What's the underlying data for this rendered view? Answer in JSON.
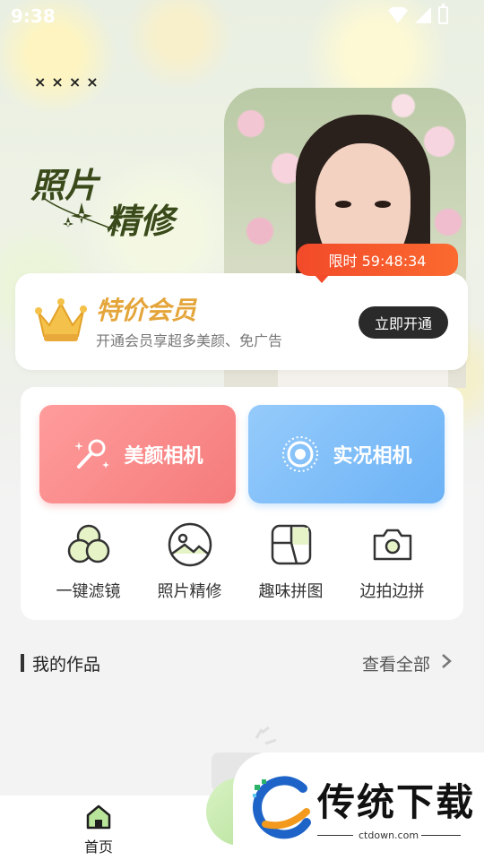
{
  "status_bar": {
    "time": "9:38"
  },
  "hero": {
    "close_marks": "××××",
    "title_line1": "照片",
    "title_line2": "精修"
  },
  "promo": {
    "countdown": "限时 59:48:34",
    "title": "特价会员",
    "subtitle": "开通会员享超多美颜、免广告",
    "cta": "立即开通"
  },
  "tools": {
    "primary": [
      {
        "label": "美颜相机",
        "icon": "makeup-brush-icon"
      },
      {
        "label": "实况相机",
        "icon": "live-photo-icon"
      }
    ],
    "secondary": [
      {
        "label": "一键滤镜",
        "icon": "filter-circles-icon"
      },
      {
        "label": "照片精修",
        "icon": "photo-edit-icon"
      },
      {
        "label": "趣味拼图",
        "icon": "collage-icon"
      },
      {
        "label": "边拍边拼",
        "icon": "camera-icon"
      }
    ]
  },
  "works": {
    "title": "我的作品",
    "view_all": "查看全部"
  },
  "bottom_nav": {
    "home_label": "首页"
  },
  "watermark": {
    "brand": "传统下载",
    "url": "ctdown.com"
  },
  "colors": {
    "beauty": "#f57b7b",
    "live": "#6cb2f6",
    "countdown": "#f24a2a",
    "vip_title": "#e4a53a"
  }
}
